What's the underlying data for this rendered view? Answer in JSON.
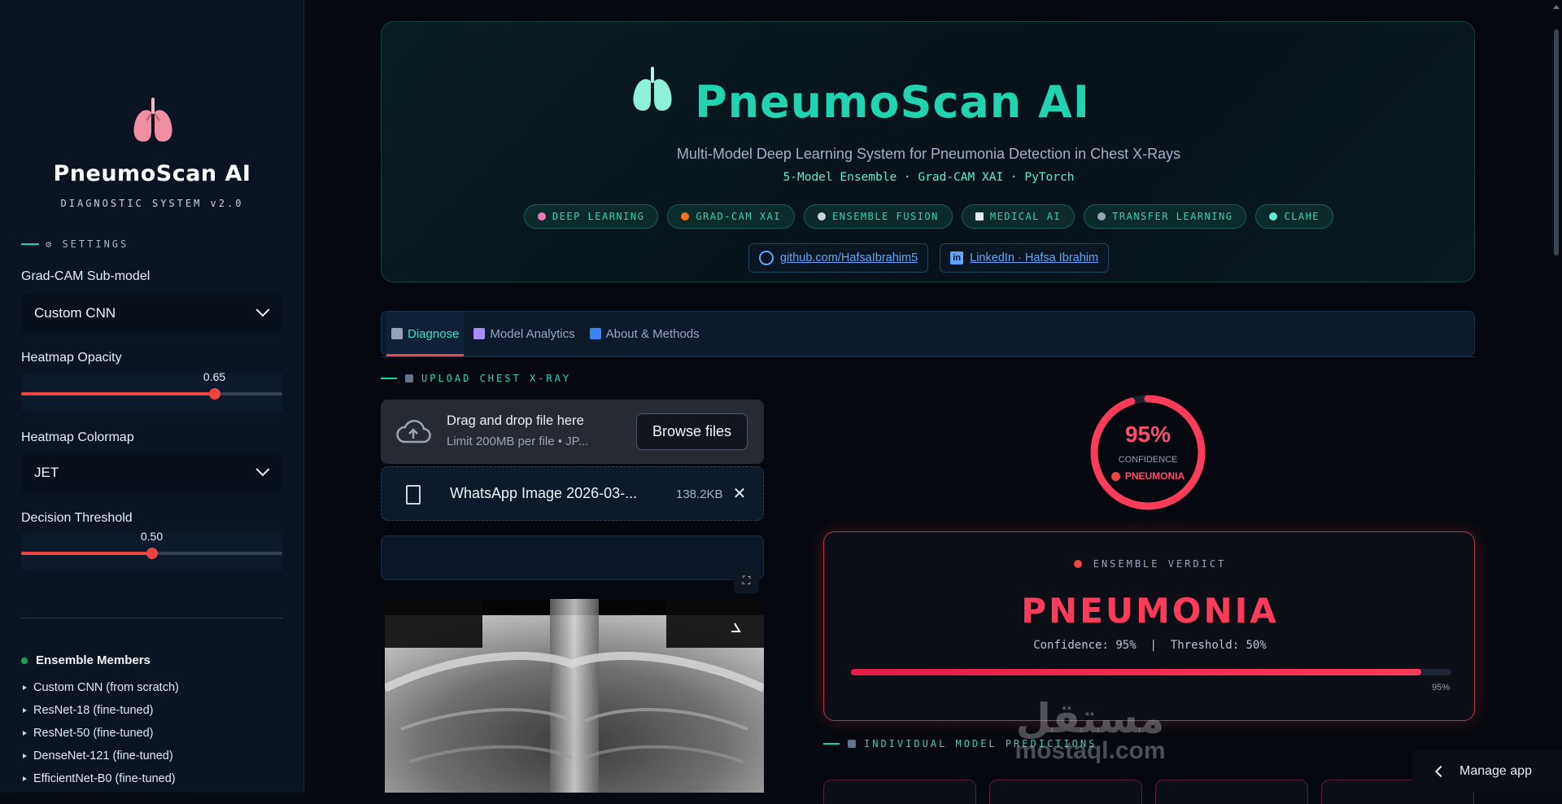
{
  "sidebar": {
    "brand_title": "PneumoScan AI",
    "brand_subtitle": "DIAGNOSTIC SYSTEM v2.0",
    "settings_label": "⚙ SETTINGS",
    "gradcam_label": "Grad-CAM Sub-model",
    "gradcam_value": "Custom CNN",
    "opacity_label": "Heatmap Opacity",
    "opacity_value": "0.65",
    "opacity_fraction": 0.74,
    "colormap_label": "Heatmap Colormap",
    "colormap_value": "JET",
    "threshold_label": "Decision Threshold",
    "threshold_value": "0.50",
    "threshold_fraction": 0.5,
    "ensemble_title": "Ensemble Members",
    "ensemble_members": [
      "Custom CNN (from scratch)",
      "ResNet-18 (fine-tuned)",
      "ResNet-50 (fine-tuned)",
      "DenseNet-121 (fine-tuned)",
      "EfficientNet-B0 (fine-tuned)"
    ]
  },
  "hero": {
    "title": "PneumoScan AI",
    "subtitle": "Multi-Model Deep Learning System for Pneumonia Detection in Chest X-Rays",
    "tech_line": "5-Model Ensemble  ·  Grad-CAM XAI  ·  PyTorch",
    "pills": [
      {
        "label": "DEEP LEARNING",
        "icon": "brain-icon",
        "color": "#f472b6"
      },
      {
        "label": "GRAD-CAM XAI",
        "icon": "fire-icon",
        "color": "#f97316"
      },
      {
        "label": "ENSEMBLE FUSION",
        "icon": "link-icon",
        "color": "#cbd5e1"
      },
      {
        "label": "MEDICAL AI",
        "icon": "document-icon",
        "color": "#e2e8f0"
      },
      {
        "label": "TRANSFER LEARNING",
        "icon": "transfer-icon",
        "color": "#94a3b8"
      },
      {
        "label": "CLAHE",
        "icon": "eye-icon",
        "color": "#5eead4"
      }
    ],
    "github_link": "github.com/HafsaIbrahim5",
    "linkedin_link": "LinkedIn · Hafsa Ibrahim"
  },
  "tabs": [
    {
      "label": "Diagnose",
      "icon": "microscope-icon",
      "active": true
    },
    {
      "label": "Model Analytics",
      "icon": "bar-chart-icon",
      "active": false
    },
    {
      "label": "About & Methods",
      "icon": "info-icon",
      "active": false
    }
  ],
  "upload": {
    "section_title": "UPLOAD CHEST X-RAY",
    "drop_title": "Drag and drop file here",
    "drop_limit": "Limit 200MB per file • JP...",
    "browse_label": "Browse files",
    "file_name": "WhatsApp Image 2026-03-...",
    "file_size": "138.2KB"
  },
  "gauge": {
    "percent_text": "95%",
    "percent_value": 95,
    "label": "CONFIDENCE",
    "class_label": "PNEUMONIA"
  },
  "verdict": {
    "header": "ENSEMBLE VERDICT",
    "title": "PNEUMONIA",
    "confidence_line": "Confidence: 95%  |  Threshold: 50%",
    "bar_value": 95,
    "bar_label": "95%"
  },
  "individual": {
    "section_title": "INDIVIDUAL MODEL PREDICTIONS"
  },
  "watermark": {
    "line1": "مستقل",
    "line2": "mostaql.com"
  },
  "manage_app": "Manage app",
  "colors": {
    "accent": "#22d3b0",
    "alert": "#ff3b5c",
    "slider": "#ef4444"
  }
}
